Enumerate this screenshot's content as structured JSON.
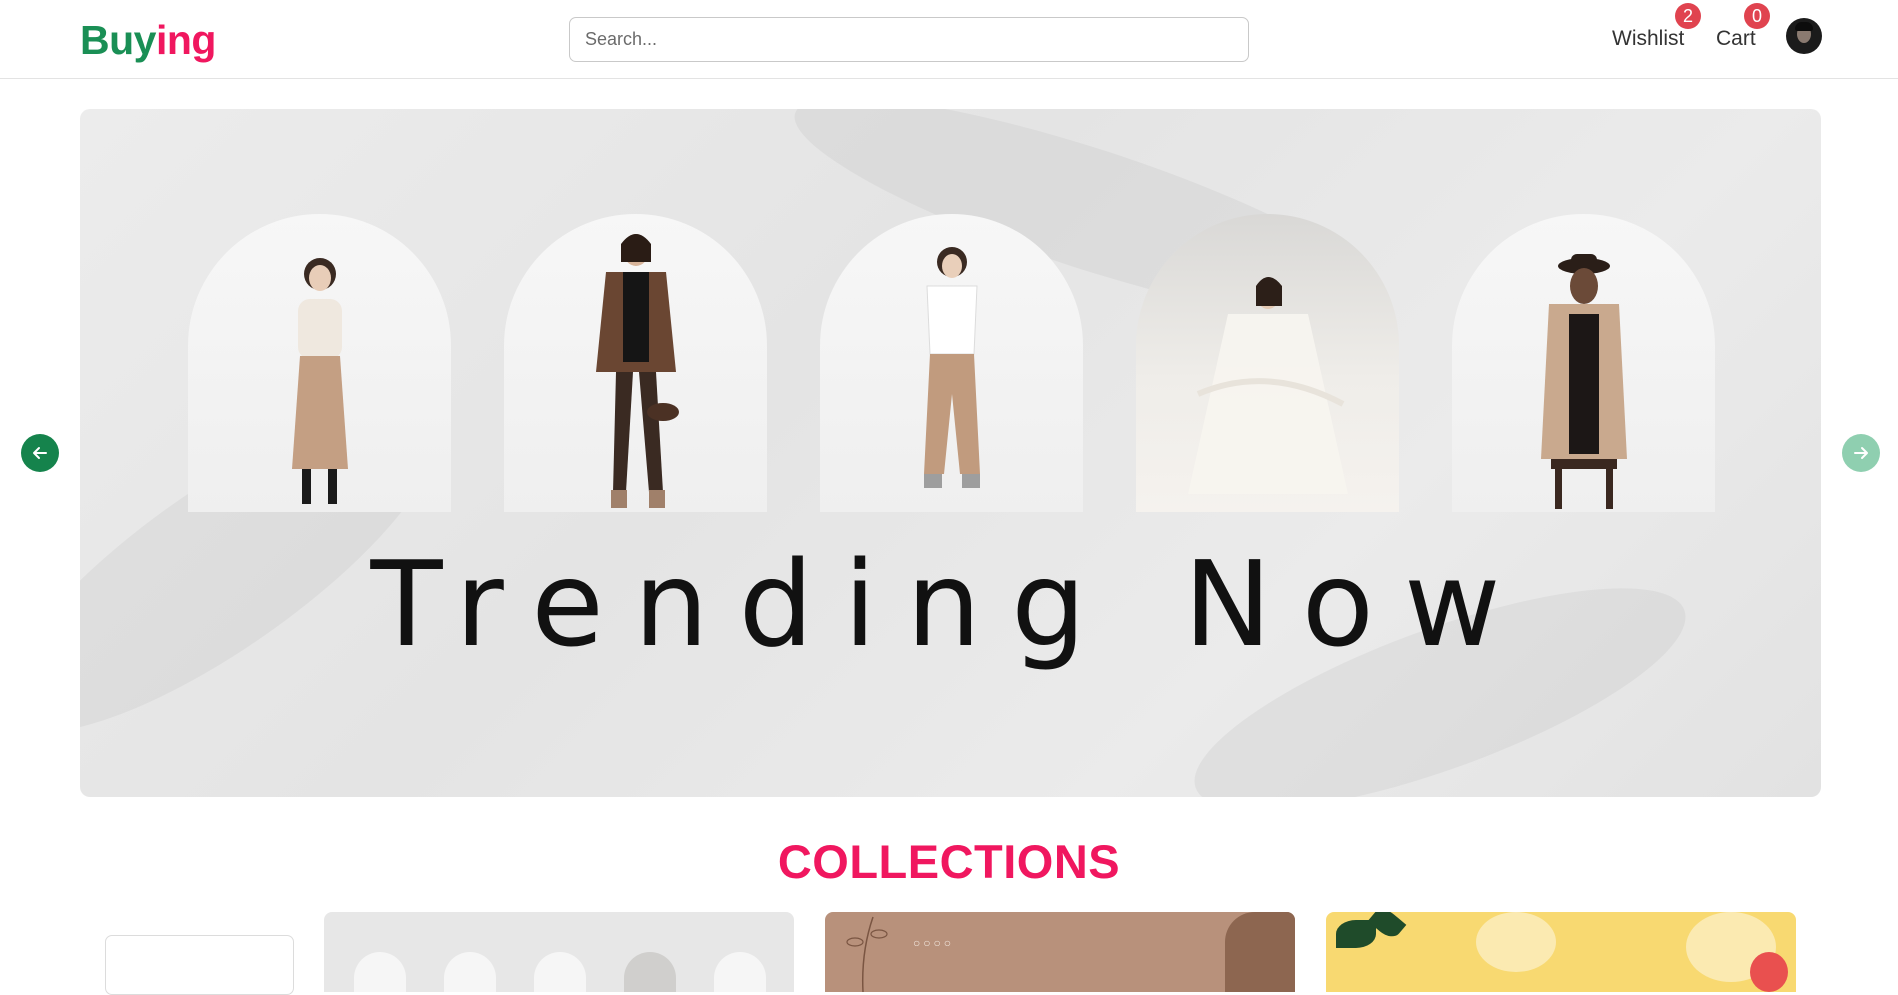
{
  "header": {
    "brand_part1": "Buy",
    "brand_part2": "ing",
    "search_placeholder": "Search...",
    "wishlist_label": "Wishlist",
    "wishlist_count": "2",
    "cart_label": "Cart",
    "cart_count": "0"
  },
  "carousel": {
    "headline": "Trending Now",
    "prev_icon": "arrow-left-icon",
    "next_icon": "arrow-right-icon"
  },
  "collections": {
    "title": "COLLECTIONS"
  },
  "colors": {
    "brand_green": "#1a8f55",
    "brand_pink": "#f0175f",
    "badge_red": "#e0434f",
    "arrow_green": "#15834c"
  }
}
